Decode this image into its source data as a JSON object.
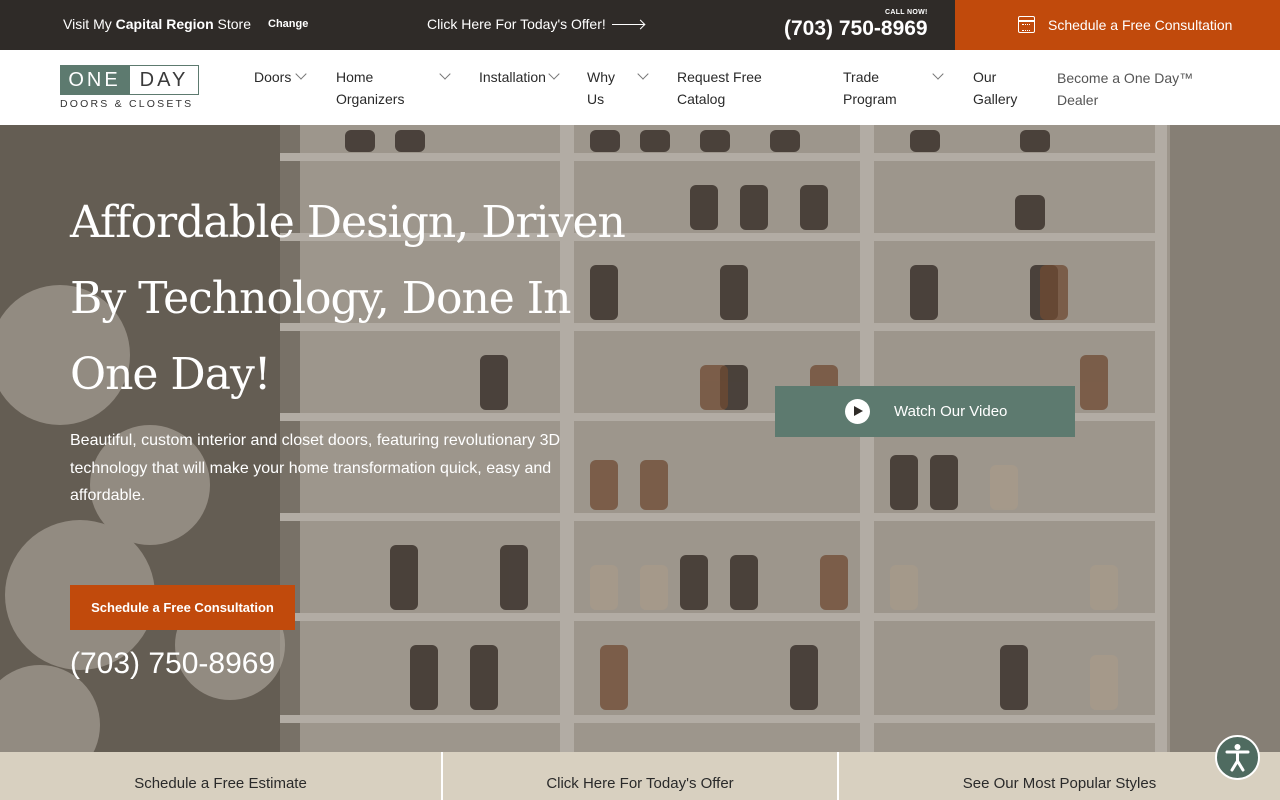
{
  "topbar": {
    "store_prefix": "Visit My ",
    "store_name": "Capital Region",
    "store_suffix": " Store",
    "change_label": "Change",
    "offer_label": "Click Here For Today's Offer!",
    "call_now_label": "CALL NOW!",
    "phone": "(703) 750-8969",
    "schedule_label": "Schedule a Free Consultation",
    "schedule_icon": "calendar-icon"
  },
  "logo": {
    "word1": "ONE",
    "word2": "DAY",
    "subtitle": "DOORS & CLOSETS"
  },
  "nav": {
    "items": [
      {
        "label": "Doors"
      },
      {
        "label": "Home Organizers"
      },
      {
        "label": "Installation"
      },
      {
        "label": "Why Us"
      },
      {
        "label": "Request Free Catalog"
      },
      {
        "label": "Trade Program"
      },
      {
        "label": "Our Gallery"
      },
      {
        "label": "Become a One Day™ Dealer"
      }
    ]
  },
  "hero": {
    "title": "Affordable Design, Driven By Technology, Done In One Day!",
    "subtitle": "Beautiful, custom interior and closet doors, featuring revolutionary 3D technology that will make your home transformation quick, easy and affordable.",
    "cta_label": "Schedule a Free Consultation",
    "phone": "(703) 750-8969",
    "video_label": "Watch Our Video"
  },
  "bottombar": {
    "items": [
      {
        "label": "Schedule a Free Estimate"
      },
      {
        "label": "Click Here For Today's Offer"
      },
      {
        "label": "See Our Most Popular Styles"
      }
    ]
  },
  "colors": {
    "topbar_bg": "#2f2b28",
    "accent_orange": "#c14a0c",
    "brand_green": "#5d7a6f",
    "bottombar_bg": "#d8d0c0"
  }
}
